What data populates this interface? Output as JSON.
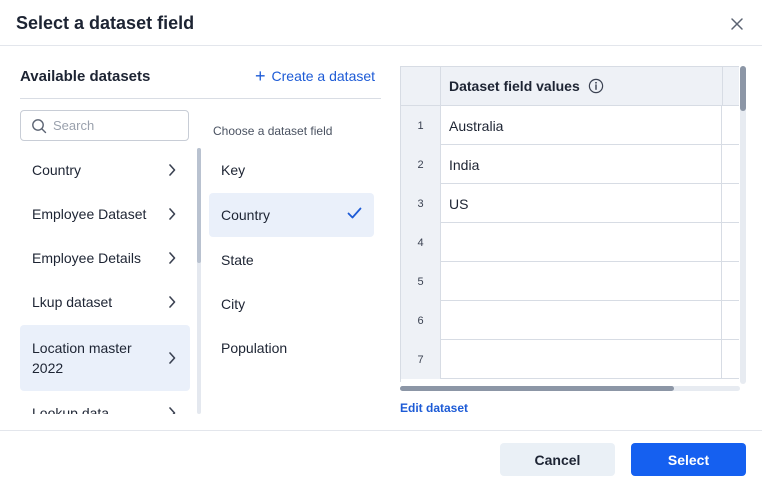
{
  "dialog": {
    "title": "Select a dataset field"
  },
  "datasets_panel": {
    "title": "Available datasets",
    "create_label": "Create a dataset",
    "search_placeholder": "Search",
    "items": [
      {
        "label": "Country",
        "selected": false
      },
      {
        "label": "Employee Dataset",
        "selected": false
      },
      {
        "label": "Employee Details",
        "selected": false
      },
      {
        "label": "Lkup dataset",
        "selected": false
      },
      {
        "label": "Location master 2022",
        "selected": true
      },
      {
        "label": "Lookup data",
        "selected": false
      }
    ]
  },
  "fields_panel": {
    "heading": "Choose a dataset field",
    "items": [
      {
        "label": "Key",
        "selected": false
      },
      {
        "label": "Country",
        "selected": true
      },
      {
        "label": "State",
        "selected": false
      },
      {
        "label": "City",
        "selected": false
      },
      {
        "label": "Population",
        "selected": false
      }
    ]
  },
  "values_grid": {
    "column_title": "Dataset field values",
    "rows": [
      {
        "num": "1",
        "value": "Australia"
      },
      {
        "num": "2",
        "value": "India"
      },
      {
        "num": "3",
        "value": "US"
      },
      {
        "num": "4",
        "value": ""
      },
      {
        "num": "5",
        "value": ""
      },
      {
        "num": "6",
        "value": ""
      },
      {
        "num": "7",
        "value": ""
      }
    ],
    "edit_label": "Edit dataset"
  },
  "footer": {
    "cancel_label": "Cancel",
    "select_label": "Select"
  },
  "colors": {
    "accent": "#1560f0",
    "link": "#1d5bd6",
    "selected_bg": "#eaf0fa"
  }
}
